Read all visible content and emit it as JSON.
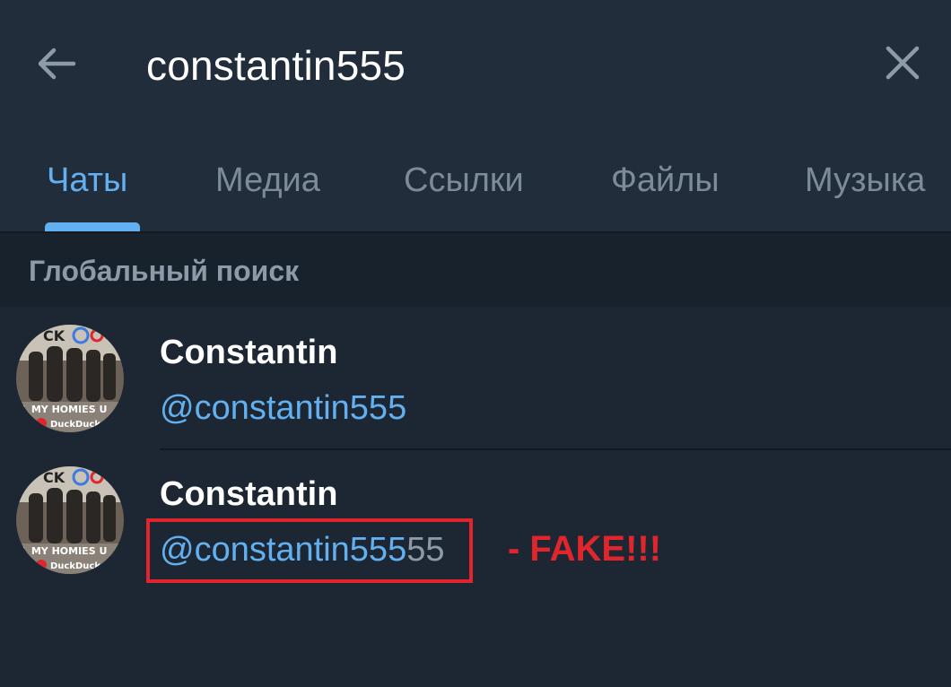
{
  "search": {
    "query": "constantin555"
  },
  "tabs": [
    {
      "label": "Чаты",
      "active": true
    },
    {
      "label": "Медиа",
      "active": false
    },
    {
      "label": "Ссылки",
      "active": false
    },
    {
      "label": "Файлы",
      "active": false
    },
    {
      "label": "Музыка",
      "active": false
    }
  ],
  "section": {
    "title": "Глобальный поиск"
  },
  "results": [
    {
      "name": "Constantin",
      "handle": "@constantin555",
      "handle_extra": "",
      "avatar_text_top": "CK",
      "avatar_text_bottom": "L MY HOMIES U",
      "avatar_text_logo": "DuckDuck"
    },
    {
      "name": "Constantin",
      "handle": "@constantin555",
      "handle_extra": "55",
      "avatar_text_top": "CK",
      "avatar_text_bottom": "L MY HOMIES U",
      "avatar_text_logo": "DuckDuck"
    }
  ],
  "annotation": {
    "label": "- FAKE!!!",
    "color": "#e0262c"
  },
  "colors": {
    "background": "#1d2733",
    "header": "#212d3b",
    "accent": "#62b0ef",
    "muted": "#7d8b99"
  },
  "icons": {
    "back": "arrow-left-icon",
    "close": "close-icon"
  }
}
